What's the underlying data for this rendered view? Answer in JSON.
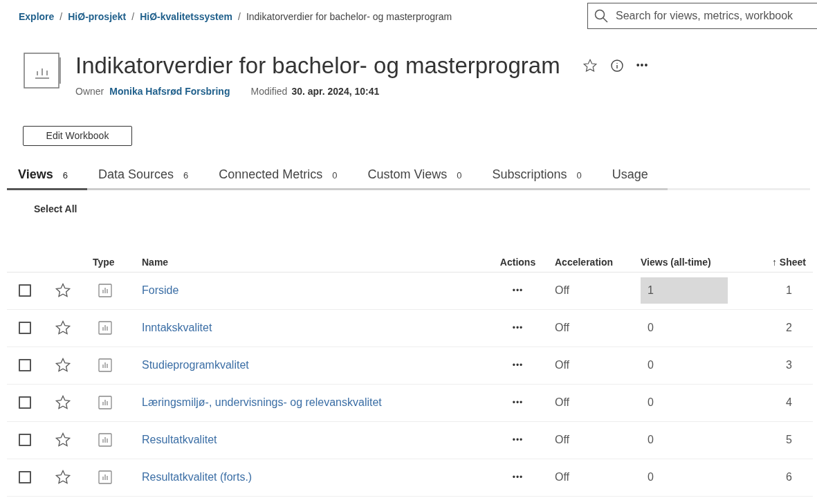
{
  "breadcrumb": [
    {
      "kind": "link",
      "label": "Explore"
    },
    {
      "kind": "separator",
      "label": "/"
    },
    {
      "kind": "link",
      "label": "HiØ-prosjekt"
    },
    {
      "kind": "separator",
      "label": "/"
    },
    {
      "kind": "link",
      "label": "HiØ-kvalitetssystem"
    },
    {
      "kind": "separator",
      "label": "/"
    },
    {
      "kind": "current",
      "label": "Indikatorverdier for bachelor- og masterprogram"
    }
  ],
  "search": {
    "placeholder": "Search for views, metrics, workbook"
  },
  "workbook": {
    "title": "Indikatorverdier for bachelor- og masterprogram",
    "owner_label": "Owner",
    "owner": "Monika Hafsrød Forsbring",
    "modified_label": "Modified",
    "modified": "30. apr. 2024, 10:41",
    "more": "•••"
  },
  "edit_button": "Edit Workbook",
  "tabs": [
    {
      "label": "Views",
      "count": "6",
      "selected": true
    },
    {
      "label": "Data Sources",
      "count": "6",
      "selected": false
    },
    {
      "label": "Connected Metrics",
      "count": "0",
      "selected": false
    },
    {
      "label": "Custom Views",
      "count": "0",
      "selected": false
    },
    {
      "label": "Subscriptions",
      "count": "0",
      "selected": false
    },
    {
      "label": "Usage",
      "selected": false
    }
  ],
  "select_all": "Select All",
  "table": {
    "columns": [
      "Type",
      "Name",
      "Actions",
      "Acceleration",
      "Views (all-time)",
      "↑ Sheet"
    ],
    "rows": [
      {
        "checked": false,
        "favorite": false,
        "name": "Forside",
        "actions": "•••",
        "acceleration": "Off",
        "views": "1",
        "highlighted": true,
        "sheet": "1"
      },
      {
        "checked": false,
        "favorite": false,
        "name": "Inntakskvalitet",
        "actions": "•••",
        "acceleration": "Off",
        "views": "0",
        "highlighted": false,
        "sheet": "2"
      },
      {
        "checked": false,
        "favorite": false,
        "name": "Studieprogramkvalitet",
        "actions": "•••",
        "acceleration": "Off",
        "views": "0",
        "highlighted": false,
        "sheet": "3"
      },
      {
        "checked": false,
        "favorite": false,
        "name": "Læringsmiljø-, undervisnings- og relevanskvalitet",
        "actions": "•••",
        "acceleration": "Off",
        "views": "0",
        "highlighted": false,
        "sheet": "4"
      },
      {
        "checked": false,
        "favorite": false,
        "name": "Resultatkvalitet",
        "actions": "•••",
        "acceleration": "Off",
        "views": "0",
        "highlighted": false,
        "sheet": "5"
      },
      {
        "checked": false,
        "favorite": false,
        "name": "Resultatkvalitet (forts.)",
        "actions": "•••",
        "acceleration": "Off",
        "views": "0",
        "highlighted": false,
        "sheet": "6"
      }
    ]
  }
}
